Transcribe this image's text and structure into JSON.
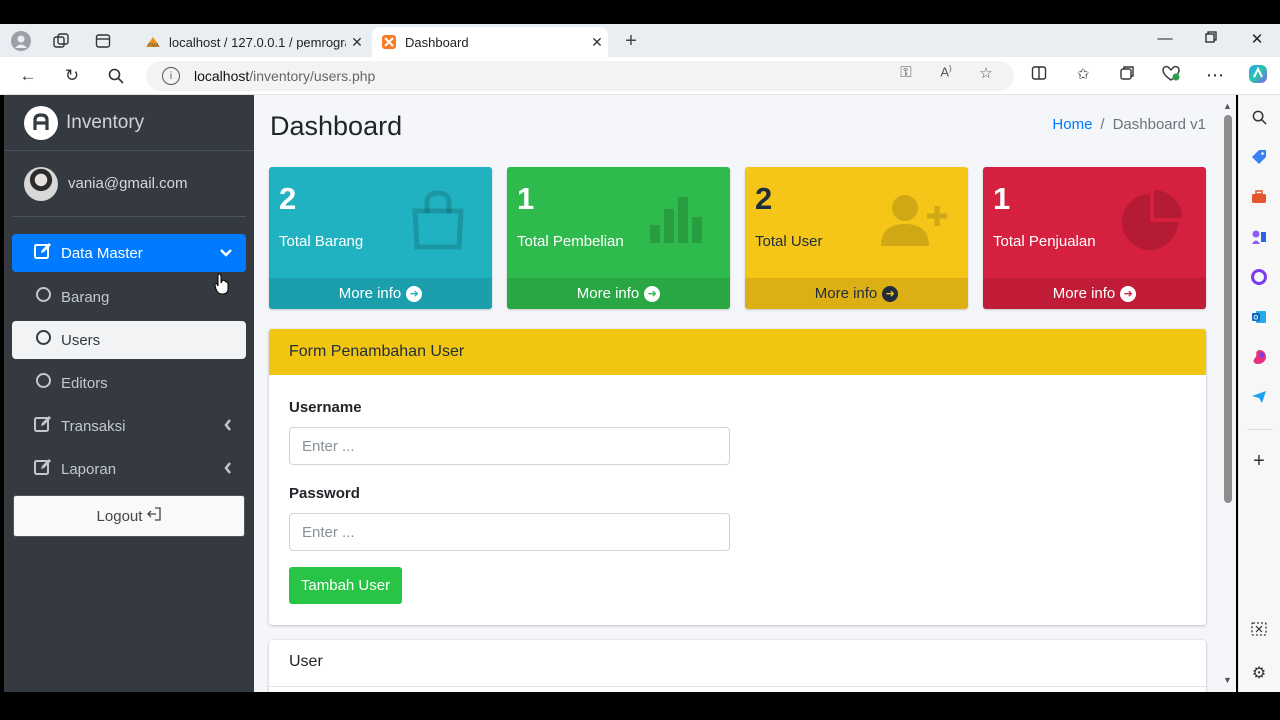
{
  "browser": {
    "tabs": [
      {
        "title": "localhost / 127.0.0.1 / pemrogran",
        "favicon": "phpmyadmin-icon",
        "active": false
      },
      {
        "title": "Dashboard",
        "favicon": "xampp-icon",
        "active": true
      }
    ],
    "url_host": "localhost",
    "url_path": "/inventory/users.php"
  },
  "sidebar": {
    "brand": "Inventory",
    "user_email": "vania@gmail.com",
    "menu": [
      {
        "label": "Data Master",
        "icon": "edit-icon",
        "state": "active"
      },
      {
        "label": "Barang",
        "icon": "circle-icon",
        "state": "normal"
      },
      {
        "label": "Users",
        "icon": "circle-icon",
        "state": "selected"
      },
      {
        "label": "Editors",
        "icon": "circle-icon",
        "state": "normal"
      },
      {
        "label": "Transaksi",
        "icon": "edit-icon",
        "state": "normal"
      },
      {
        "label": "Laporan",
        "icon": "edit-icon",
        "state": "normal"
      }
    ],
    "logout_label": "Logout"
  },
  "header": {
    "title": "Dashboard",
    "breadcrumb_home": "Home",
    "breadcrumb_sep": "/",
    "breadcrumb_current": "Dashboard v1"
  },
  "stats": [
    {
      "value": "2",
      "label": "Total Barang",
      "link": "More info",
      "color": "#20b2c0",
      "icon": "shopping-bag-icon"
    },
    {
      "value": "1",
      "label": "Total Pembelian",
      "link": "More info",
      "color": "#2fba4d",
      "icon": "bar-chart-icon"
    },
    {
      "value": "2",
      "label": "Total User",
      "link": "More info",
      "color": "#f5c518",
      "icon": "user-plus-icon"
    },
    {
      "value": "1",
      "label": "Total Penjualan",
      "link": "More info",
      "color": "#d6203f",
      "icon": "pie-chart-icon"
    }
  ],
  "form": {
    "title": "Form Penambahan User",
    "username_label": "Username",
    "username_placeholder": "Enter ...",
    "password_label": "Password",
    "password_placeholder": "Enter ...",
    "submit_label": "Tambah User"
  },
  "user_card": {
    "title": "User"
  }
}
